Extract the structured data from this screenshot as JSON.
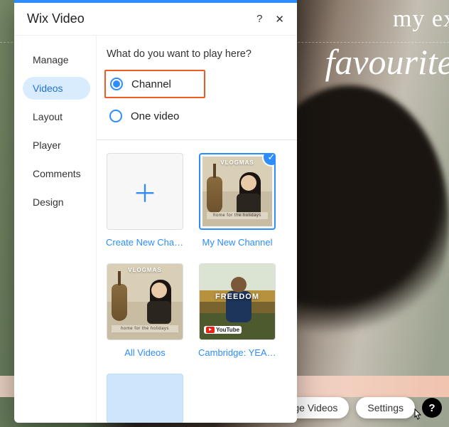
{
  "background": {
    "line1": "my ex",
    "line2": "favourite"
  },
  "bottom": {
    "manage_videos_partial": "age Videos",
    "settings": "Settings",
    "help": "?"
  },
  "panel": {
    "title": "Wix Video",
    "help": "?",
    "close": "✕"
  },
  "sidebar": {
    "items": [
      "Manage",
      "Videos",
      "Layout",
      "Player",
      "Comments",
      "Design"
    ],
    "active_index": 1
  },
  "content": {
    "question": "What do you want to play here?",
    "options": {
      "channel": "Channel",
      "one_video": "One video"
    },
    "tiles": {
      "create": "Create New Channel",
      "my_new": "My New Channel",
      "all": "All Videos",
      "cambridge": "Cambridge: YEAR …"
    },
    "thumb": {
      "vlogmas": "VLOGMAS",
      "holidays_caption": "home for the holidays",
      "freedom": "FREEDOM",
      "youtube": "YouTube"
    }
  }
}
